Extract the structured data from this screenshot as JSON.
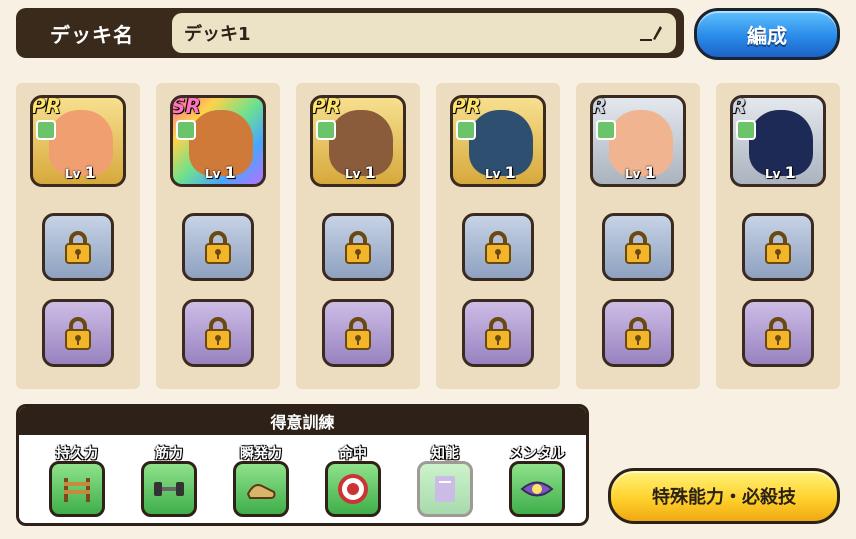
{
  "header": {
    "deck_label": "デッキ名",
    "deck_name": "デッキ1",
    "edit_button": "編成"
  },
  "deck": {
    "slots": [
      {
        "rarity": "PR",
        "level_prefix": "Lv",
        "level": "1",
        "type_icon": "dumbbell-type-icon",
        "face_color": "#f0a070"
      },
      {
        "rarity": "SR",
        "level_prefix": "Lv",
        "level": "1",
        "type_icon": "hurdle-type-icon",
        "face_color": "#d07a3a"
      },
      {
        "rarity": "PR",
        "level_prefix": "Lv",
        "level": "1",
        "type_icon": "shoe-type-icon",
        "face_color": "#8a5c3c"
      },
      {
        "rarity": "PR",
        "level_prefix": "Lv",
        "level": "1",
        "type_icon": "target-type-icon",
        "face_color": "#2f4f70"
      },
      {
        "rarity": "R",
        "level_prefix": "Lv",
        "level": "1",
        "type_icon": "brain-type-icon",
        "face_color": "#f0b490"
      },
      {
        "rarity": "R",
        "level_prefix": "Lv",
        "level": "1",
        "type_icon": "heart-type-icon",
        "face_color": "#1d2a55"
      }
    ]
  },
  "training": {
    "title": "得意訓練",
    "items": [
      {
        "label": "持久力",
        "icon": "hurdle-icon",
        "enabled": true
      },
      {
        "label": "筋力",
        "icon": "dumbbell-icon",
        "enabled": true
      },
      {
        "label": "瞬発力",
        "icon": "shoe-icon",
        "enabled": true
      },
      {
        "label": "命中",
        "icon": "target-icon",
        "enabled": true
      },
      {
        "label": "知能",
        "icon": "book-icon",
        "enabled": false
      },
      {
        "label": "メンタル",
        "icon": "eye-icon",
        "enabled": true
      }
    ]
  },
  "special_button": "特殊能力・必殺技"
}
